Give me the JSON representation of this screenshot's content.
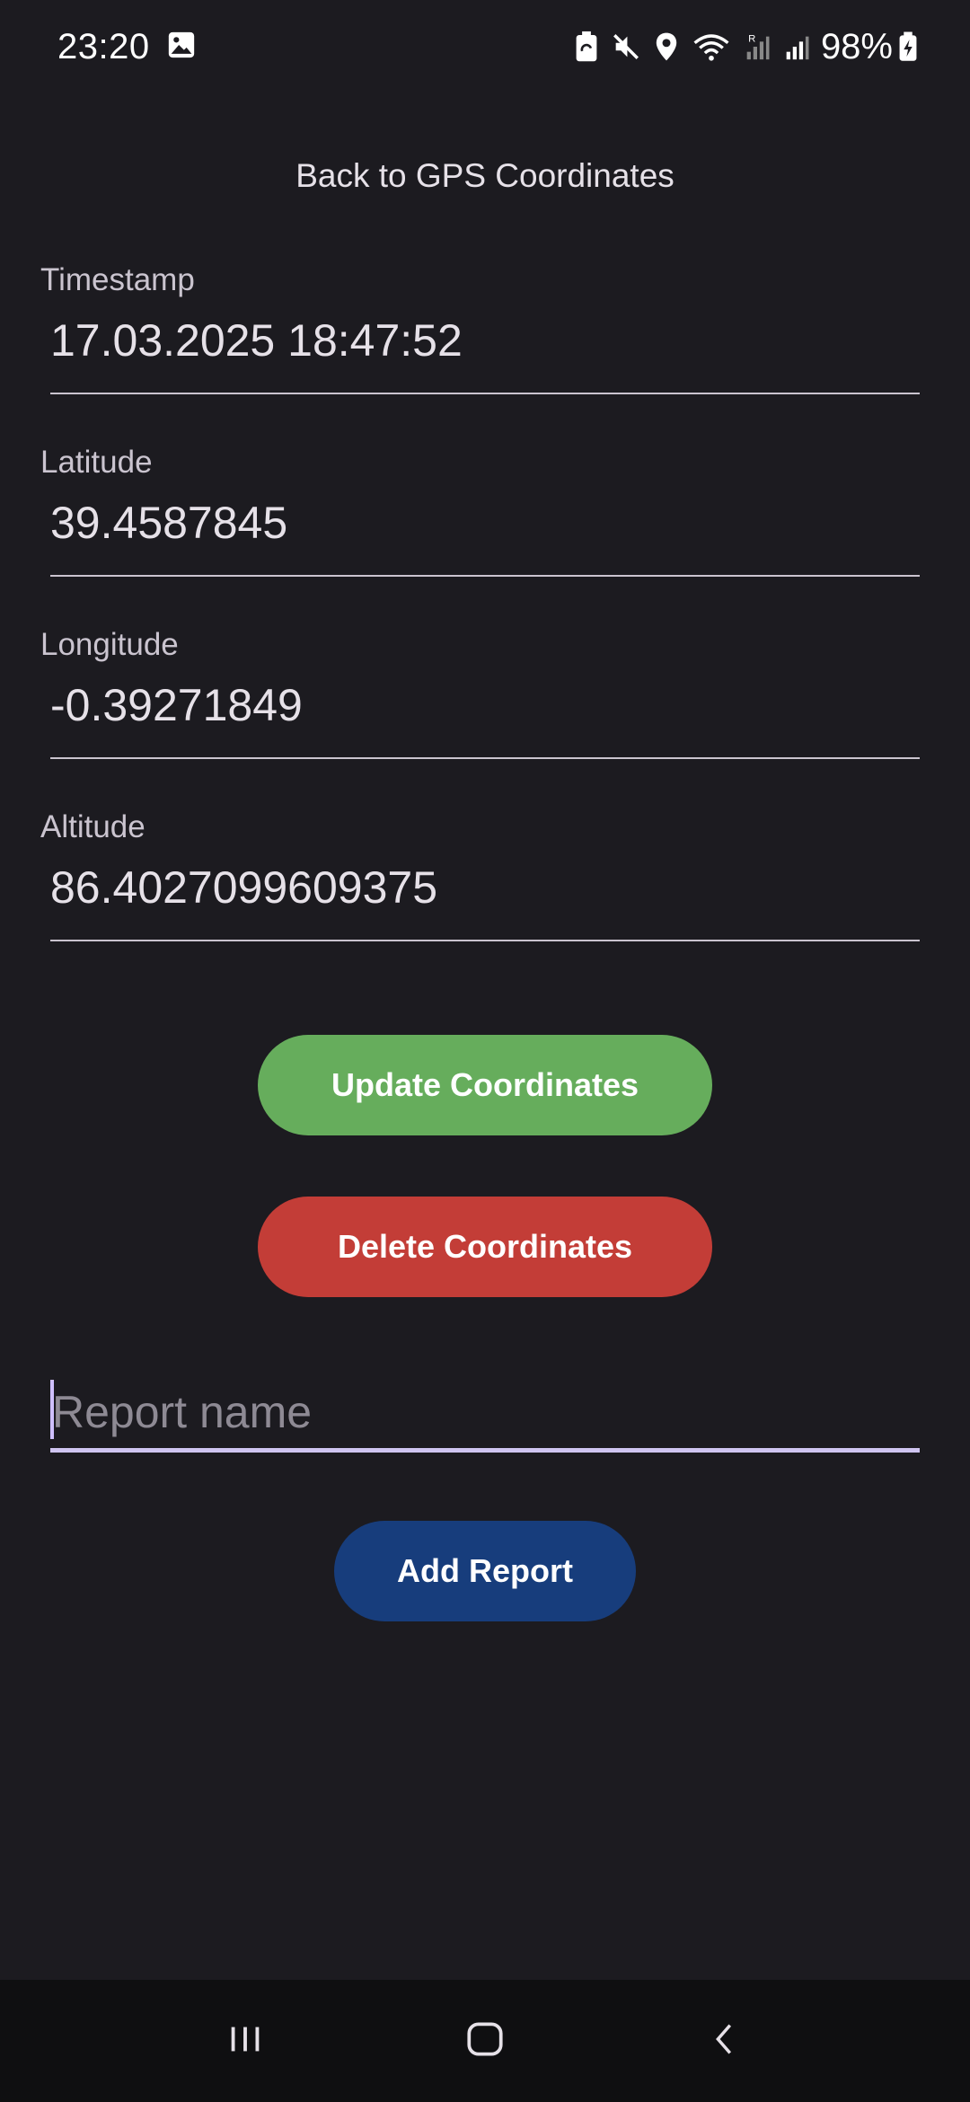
{
  "status_bar": {
    "time": "23:20",
    "battery_percent": "98%",
    "icons": [
      "image-icon",
      "battery-saver-icon",
      "mute-icon",
      "location-icon",
      "wifi-icon",
      "signal-roaming-icon",
      "signal-icon",
      "battery-charging-icon"
    ]
  },
  "header": {
    "back_label": "Back to GPS Coordinates"
  },
  "fields": {
    "timestamp": {
      "label": "Timestamp",
      "value": "17.03.2025 18:47:52"
    },
    "latitude": {
      "label": "Latitude",
      "value": "39.4587845"
    },
    "longitude": {
      "label": "Longitude",
      "value": "-0.39271849"
    },
    "altitude": {
      "label": "Altitude",
      "value": "86.4027099609375"
    }
  },
  "actions": {
    "update_label": "Update Coordinates",
    "delete_label": "Delete Coordinates",
    "add_report_label": "Add Report"
  },
  "report": {
    "placeholder": "Report name",
    "value": ""
  },
  "nav": {
    "items": [
      "recents-icon",
      "home-icon",
      "back-icon"
    ]
  },
  "colors": {
    "background": "#1c1b20",
    "update_button": "#66ad5c",
    "delete_button": "#c33d37",
    "add_report_button": "#173d7c",
    "nav_bar": "#0f0f11"
  }
}
